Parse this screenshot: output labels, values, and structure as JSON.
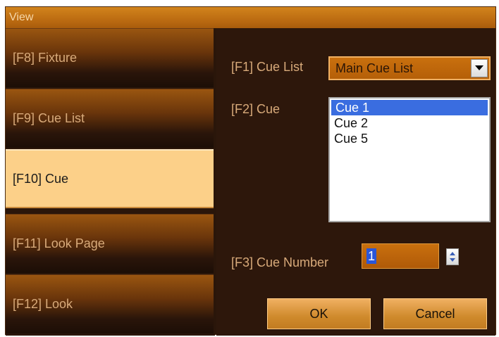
{
  "window": {
    "title": "View"
  },
  "sidebar": {
    "items": [
      {
        "label": "[F8] Fixture",
        "active": false
      },
      {
        "label": "[F9] Cue List",
        "active": false
      },
      {
        "label": "[F10] Cue",
        "active": true
      },
      {
        "label": "[F11] Look Page",
        "active": false
      },
      {
        "label": "[F12] Look",
        "active": false
      }
    ]
  },
  "form": {
    "cue_list_label": "[F1] Cue List",
    "cue_list_value": "Main Cue List",
    "cue_label": "[F2] Cue",
    "cues": [
      "Cue 1",
      "Cue 2",
      "Cue 5"
    ],
    "selected_cue": "Cue 1",
    "cue_number_label": "[F3] Cue Number",
    "cue_number_value": "1"
  },
  "buttons": {
    "ok": "OK",
    "cancel": "Cancel"
  },
  "colors": {
    "accent_orange": "#c9700e",
    "active_tab": "#fcd089",
    "selection_blue": "#3a6de0"
  }
}
